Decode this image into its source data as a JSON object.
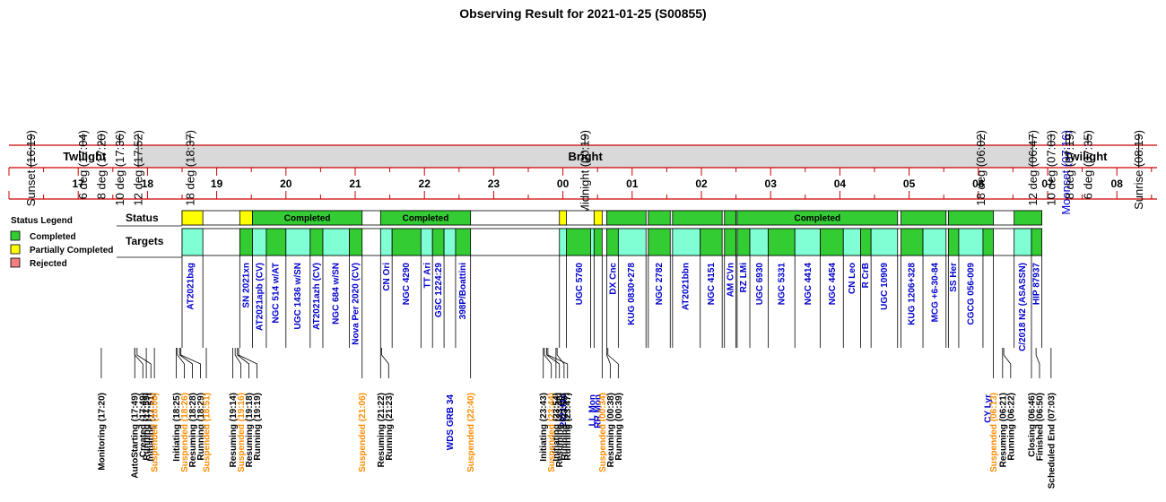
{
  "chart_data": {
    "type": "timeline",
    "title": "Observing Result for 2021-01-25 (S00855)",
    "time_range": [
      "16:00",
      "08:40"
    ],
    "top_markers": [
      {
        "label": "Sunset (16:19)",
        "time": "16:19",
        "color": "#000000"
      },
      {
        "label": "6 deg (17:04)",
        "time": "17:04",
        "color": "#000000"
      },
      {
        "label": "8 deg (17:20)",
        "time": "17:20",
        "color": "#000000"
      },
      {
        "label": "10 deg (17:36)",
        "time": "17:36",
        "color": "#000000"
      },
      {
        "label": "12 deg (17:52)",
        "time": "17:52",
        "color": "#000000"
      },
      {
        "label": "18 deg (18:37)",
        "time": "18:37",
        "color": "#000000"
      },
      {
        "label": "Midnight (00:19)",
        "time": "00:19",
        "color": "#000000"
      },
      {
        "label": "18 deg (06:02)",
        "time": "06:02",
        "color": "#000000"
      },
      {
        "label": "12 deg (06:47)",
        "time": "06:47",
        "color": "#000000"
      },
      {
        "label": "10 deg (07:03)",
        "time": "07:03",
        "color": "#000000"
      },
      {
        "label": "Moonset (07:16)",
        "time": "07:16",
        "color": "#0000cc"
      },
      {
        "label": "8 deg (07:19)",
        "time": "07:19",
        "color": "#000000"
      },
      {
        "label": "6 deg (07:35)",
        "time": "07:35",
        "color": "#000000"
      },
      {
        "label": "Sunrise (08:19)",
        "time": "08:19",
        "color": "#000000"
      }
    ],
    "bands": [
      {
        "label": "Twilight",
        "start": "16:19",
        "end": "17:52",
        "fill": "#ffffff"
      },
      {
        "label": "Bright",
        "start": "17:52",
        "end": "06:47",
        "fill": "#d9d9d9"
      },
      {
        "label": "Twilight",
        "start": "06:47",
        "end": "08:19",
        "fill": "#ffffff"
      }
    ],
    "hour_labels": [
      "17",
      "18",
      "19",
      "20",
      "21",
      "22",
      "23",
      "00",
      "01",
      "02",
      "03",
      "04",
      "05",
      "06",
      "07",
      "08"
    ],
    "legend": {
      "title": "Status Legend",
      "items": [
        {
          "label": "Completed",
          "color": "#33cc33"
        },
        {
          "label": "Partially Completed",
          "color": "#ffff00"
        },
        {
          "label": "Rejected",
          "color": "#f08080"
        }
      ]
    },
    "row_labels": {
      "status": "Status",
      "targets": "Targets"
    },
    "status_blocks": [
      {
        "start": "18:30",
        "end": "18:48",
        "status": "partial",
        "label": ""
      },
      {
        "start": "19:20",
        "end": "19:31",
        "status": "partial",
        "label": ""
      },
      {
        "start": "19:31",
        "end": "21:06",
        "status": "completed",
        "label": "Completed"
      },
      {
        "start": "21:22",
        "end": "22:40",
        "status": "completed",
        "label": "Completed"
      },
      {
        "start": "23:57",
        "end": "00:03",
        "status": "partial",
        "label": ""
      },
      {
        "start": "00:27",
        "end": "00:34",
        "status": "partial",
        "label": ""
      },
      {
        "start": "00:38",
        "end": "01:12",
        "status": "completed",
        "label": ""
      },
      {
        "start": "01:14",
        "end": "01:33",
        "status": "completed",
        "label": ""
      },
      {
        "start": "01:35",
        "end": "02:18",
        "status": "completed",
        "label": ""
      },
      {
        "start": "02:20",
        "end": "02:30",
        "status": "completed",
        "label": ""
      },
      {
        "start": "02:31",
        "end": "04:50",
        "status": "completed",
        "label": "Completed"
      },
      {
        "start": "04:53",
        "end": "05:32",
        "status": "completed",
        "label": ""
      },
      {
        "start": "05:34",
        "end": "06:13",
        "status": "completed",
        "label": ""
      },
      {
        "start": "06:31",
        "end": "06:55",
        "status": "completed",
        "label": ""
      }
    ],
    "target_blocks": [
      {
        "start": "18:30",
        "end": "18:48",
        "color": "#80ffd4",
        "name": "AT2021bag"
      },
      {
        "start": "19:20",
        "end": "19:31",
        "color": "#33cc33",
        "name": "SN 2021xn"
      },
      {
        "start": "19:31",
        "end": "19:43",
        "color": "#80ffd4",
        "name": "AT2021apb (CV)"
      },
      {
        "start": "19:43",
        "end": "20:00",
        "color": "#33cc33",
        "name": "NGC 514 w/AT"
      },
      {
        "start": "20:00",
        "end": "20:21",
        "color": "#80ffd4",
        "name": "UGC 1436 w/SN"
      },
      {
        "start": "20:21",
        "end": "20:32",
        "color": "#33cc33",
        "name": "AT2021azh (CV)"
      },
      {
        "start": "20:32",
        "end": "20:55",
        "color": "#80ffd4",
        "name": "NGC 684 w/SN"
      },
      {
        "start": "20:55",
        "end": "21:06",
        "color": "#33cc33",
        "name": "Nova Per 2020 (CV)"
      },
      {
        "start": "21:22",
        "end": "21:32",
        "color": "#80ffd4",
        "name": "CN Ori"
      },
      {
        "start": "21:32",
        "end": "21:57",
        "color": "#33cc33",
        "name": "NGC 4290"
      },
      {
        "start": "21:57",
        "end": "22:07",
        "color": "#80ffd4",
        "name": "TT Ari"
      },
      {
        "start": "22:07",
        "end": "22:17",
        "color": "#33cc33",
        "name": "GSC 1224:29"
      },
      {
        "start": "22:17",
        "end": "22:27",
        "color": "#80ffd4",
        "name": "WDS GRB 34"
      },
      {
        "start": "22:27",
        "end": "22:40",
        "color": "#33cc33",
        "name": "398P/Boattini"
      },
      {
        "start": "23:57",
        "end": "00:03",
        "color": "#80ffd4",
        "name": "2021Mx"
      },
      {
        "start": "00:03",
        "end": "00:24",
        "color": "#33cc33",
        "name": "UGC 5760"
      },
      {
        "start": "00:24",
        "end": "00:27",
        "color": "#80ffd4",
        "name": "LL Mon"
      },
      {
        "start": "00:27",
        "end": "00:34",
        "color": "#33cc33",
        "name": "RR Mon"
      },
      {
        "start": "00:38",
        "end": "00:48",
        "color": "#33cc33",
        "name": "DX Cnc"
      },
      {
        "start": "00:48",
        "end": "01:12",
        "color": "#80ffd4",
        "name": "KUG 0830+278"
      },
      {
        "start": "01:14",
        "end": "01:33",
        "color": "#33cc33",
        "name": "NGC 2782"
      },
      {
        "start": "01:35",
        "end": "01:59",
        "color": "#80ffd4",
        "name": "AT2021bbn"
      },
      {
        "start": "01:59",
        "end": "02:18",
        "color": "#33cc33",
        "name": "NGC 4151"
      },
      {
        "start": "02:20",
        "end": "02:30",
        "color": "#33cc33",
        "name": "AM CVn"
      },
      {
        "start": "02:31",
        "end": "02:42",
        "color": "#33cc33",
        "name": "RZ LMi"
      },
      {
        "start": "02:42",
        "end": "02:58",
        "color": "#80ffd4",
        "name": "UGC 6930"
      },
      {
        "start": "02:58",
        "end": "03:21",
        "color": "#33cc33",
        "name": "NGC 5331"
      },
      {
        "start": "03:21",
        "end": "03:43",
        "color": "#80ffd4",
        "name": "NGC 4414"
      },
      {
        "start": "03:43",
        "end": "04:03",
        "color": "#33cc33",
        "name": "NGC 4454"
      },
      {
        "start": "04:03",
        "end": "04:18",
        "color": "#80ffd4",
        "name": "CN Leo"
      },
      {
        "start": "04:18",
        "end": "04:27",
        "color": "#33cc33",
        "name": "R CrB"
      },
      {
        "start": "04:27",
        "end": "04:50",
        "color": "#80ffd4",
        "name": "UGC 10909"
      },
      {
        "start": "04:53",
        "end": "05:12",
        "color": "#33cc33",
        "name": "KUG 1206+328"
      },
      {
        "start": "05:12",
        "end": "05:32",
        "color": "#80ffd4",
        "name": "MCG +6-30-84"
      },
      {
        "start": "05:34",
        "end": "05:43",
        "color": "#33cc33",
        "name": "SS Her"
      },
      {
        "start": "05:43",
        "end": "06:04",
        "color": "#80ffd4",
        "name": "CGCG 056-009"
      },
      {
        "start": "06:04",
        "end": "06:13",
        "color": "#33cc33",
        "name": "CY Lyr"
      },
      {
        "start": "06:31",
        "end": "06:46",
        "color": "#80ffd4",
        "name": "C/2018 N2 (ASASSN)"
      },
      {
        "start": "06:46",
        "end": "06:55",
        "color": "#33cc33",
        "name": "HIP 87937"
      }
    ],
    "target_labels": [
      {
        "name": "AT2021bag",
        "time": "18:37",
        "color": "#0000cc",
        "drop": 0
      },
      {
        "name": "SN 2021xn",
        "time": "19:25",
        "color": "#0000cc",
        "drop": 0
      },
      {
        "name": "AT2021apb (CV)",
        "time": "19:37",
        "color": "#0000cc",
        "drop": 0
      },
      {
        "name": "NGC 514 w/AT",
        "time": "19:51",
        "color": "#0000cc",
        "drop": 0
      },
      {
        "name": "UGC 1436 w/SN",
        "time": "20:10",
        "color": "#0000cc",
        "drop": 0
      },
      {
        "name": "AT2021azh (CV)",
        "time": "20:26",
        "color": "#0000cc",
        "drop": 0
      },
      {
        "name": "NGC 684 w/SN",
        "time": "20:43",
        "color": "#0000cc",
        "drop": 0
      },
      {
        "name": "Nova Per 2020 (CV)",
        "time": "21:00",
        "color": "#0000cc",
        "drop": 0
      },
      {
        "name": "CN Ori",
        "time": "21:27",
        "color": "#0000cc",
        "drop": 0
      },
      {
        "name": "NGC 4290",
        "time": "21:44",
        "color": "#0000cc",
        "drop": 0
      },
      {
        "name": "TT Ari",
        "time": "22:02",
        "color": "#0000cc",
        "drop": 0
      },
      {
        "name": "GSC 1224:29",
        "time": "22:12",
        "color": "#0000cc",
        "drop": 0
      },
      {
        "name": "WDS GRB 34",
        "time": "22:22",
        "color": "#0000cc",
        "drop": 1
      },
      {
        "name": "398P/Boattini",
        "time": "22:33",
        "color": "#0000cc",
        "drop": 0
      },
      {
        "name": "2021Mx",
        "time": "00:00",
        "color": "#0000cc",
        "drop": 1
      },
      {
        "name": "UGC 5760",
        "time": "00:14",
        "color": "#0000cc",
        "drop": 0
      },
      {
        "name": "LL Mon",
        "time": "00:25",
        "color": "#0000cc",
        "drop": 1
      },
      {
        "name": "RR Mon",
        "time": "00:30",
        "color": "#0000cc",
        "drop": 1
      },
      {
        "name": "DX Cnc",
        "time": "00:43",
        "color": "#0000cc",
        "drop": 0
      },
      {
        "name": "KUG 0830+278",
        "time": "00:59",
        "color": "#0000cc",
        "drop": 0
      },
      {
        "name": "NGC 2782",
        "time": "01:23",
        "color": "#0000cc",
        "drop": 0
      },
      {
        "name": "AT2021bbn",
        "time": "01:46",
        "color": "#0000cc",
        "drop": 0
      },
      {
        "name": "NGC 4151",
        "time": "02:08",
        "color": "#0000cc",
        "drop": 0
      },
      {
        "name": "AM CVn",
        "time": "02:25",
        "color": "#0000cc",
        "drop": 0
      },
      {
        "name": "RZ LMi",
        "time": "02:36",
        "color": "#0000cc",
        "drop": 0
      },
      {
        "name": "UGC 6930",
        "time": "02:50",
        "color": "#0000cc",
        "drop": 0
      },
      {
        "name": "NGC 5331",
        "time": "03:09",
        "color": "#0000cc",
        "drop": 0
      },
      {
        "name": "NGC 4414",
        "time": "03:32",
        "color": "#0000cc",
        "drop": 0
      },
      {
        "name": "NGC 4454",
        "time": "03:53",
        "color": "#0000cc",
        "drop": 0
      },
      {
        "name": "CN Leo",
        "time": "04:10",
        "color": "#0000cc",
        "drop": 0
      },
      {
        "name": "R CrB",
        "time": "04:22",
        "color": "#0000cc",
        "drop": 0
      },
      {
        "name": "UGC 10909",
        "time": "04:38",
        "color": "#0000cc",
        "drop": 0
      },
      {
        "name": "KUG 1206+328",
        "time": "05:02",
        "color": "#0000cc",
        "drop": 0
      },
      {
        "name": "MCG +6-30-84",
        "time": "05:22",
        "color": "#0000cc",
        "drop": 0
      },
      {
        "name": "SS Her",
        "time": "05:38",
        "color": "#0000cc",
        "drop": 0
      },
      {
        "name": "CGCG 056-009",
        "time": "05:53",
        "color": "#0000cc",
        "drop": 0
      },
      {
        "name": "CY Lyr",
        "time": "06:08",
        "color": "#0000cc",
        "drop": 1
      },
      {
        "name": "C/2018 N2 (ASASSN)",
        "time": "06:38",
        "color": "#0000cc",
        "drop": 0
      },
      {
        "name": "HIP 87937",
        "time": "06:50",
        "color": "#0000cc",
        "drop": 0
      }
    ],
    "events": [
      {
        "label": "Monitoring (17:20)",
        "time": "17:20",
        "color": "#000000"
      },
      {
        "label": "AutoStarting (17:49)",
        "time": "17:49",
        "color": "#000000"
      },
      {
        "label": "Created (17:49)",
        "time": "17:49",
        "color": "#000000"
      },
      {
        "label": "Initiating (17:51)",
        "time": "17:51",
        "color": "#000000"
      },
      {
        "label": "Running (17:59)",
        "time": "17:59",
        "color": "#000000"
      },
      {
        "label": "Suspended (18:06)",
        "time": "18:06",
        "color": "#ff8c00"
      },
      {
        "label": "Initiating (18:25)",
        "time": "18:25",
        "color": "#000000"
      },
      {
        "label": "Suspended (18:26)",
        "time": "18:26",
        "color": "#ff8c00"
      },
      {
        "label": "Resuming (18:28)",
        "time": "18:28",
        "color": "#000000"
      },
      {
        "label": "Running (18:29)",
        "time": "18:29",
        "color": "#000000"
      },
      {
        "label": "Suspended (18:51)",
        "time": "18:51",
        "color": "#ff8c00"
      },
      {
        "label": "Resuming (19:14)",
        "time": "19:14",
        "color": "#000000"
      },
      {
        "label": "Suspended (19:16)",
        "time": "19:16",
        "color": "#ff8c00"
      },
      {
        "label": "Resuming (19:18)",
        "time": "19:18",
        "color": "#000000"
      },
      {
        "label": "Running (19:19)",
        "time": "19:19",
        "color": "#000000"
      },
      {
        "label": "Suspended (21:06)",
        "time": "21:06",
        "color": "#ff8c00"
      },
      {
        "label": "Resuming (21:22)",
        "time": "21:22",
        "color": "#000000"
      },
      {
        "label": "Running (21:23)",
        "time": "21:23",
        "color": "#000000"
      },
      {
        "label": "Suspended (22:40)",
        "time": "22:40",
        "color": "#ff8c00"
      },
      {
        "label": "Initiating (23:43)",
        "time": "23:43",
        "color": "#000000"
      },
      {
        "label": "Suspended (23:44)",
        "time": "23:44",
        "color": "#ff8c00"
      },
      {
        "label": "Resuming (23:46)",
        "time": "23:46",
        "color": "#000000"
      },
      {
        "label": "Running (23:47)",
        "time": "23:47",
        "color": "#000000"
      },
      {
        "label": "Initiating (23:54)",
        "time": "23:54",
        "color": "#000000"
      },
      {
        "label": "Running (23:55)",
        "time": "23:55",
        "color": "#000000"
      },
      {
        "label": "Suspended (00:34)",
        "time": "00:34",
        "color": "#ff8c00"
      },
      {
        "label": "Resuming (00:38)",
        "time": "00:38",
        "color": "#000000"
      },
      {
        "label": "Running (00:39)",
        "time": "00:39",
        "color": "#000000"
      },
      {
        "label": "Suspended (06:13)",
        "time": "06:13",
        "color": "#ff8c00"
      },
      {
        "label": "Resuming (06:21)",
        "time": "06:21",
        "color": "#000000"
      },
      {
        "label": "Running (06:22)",
        "time": "06:22",
        "color": "#000000"
      },
      {
        "label": "Closing (06:46)",
        "time": "06:46",
        "color": "#000000"
      },
      {
        "label": "Finished (06:50)",
        "time": "06:50",
        "color": "#000000"
      },
      {
        "label": "Scheduled End (07:03)",
        "time": "07:03",
        "color": "#000000"
      }
    ],
    "colors": {
      "completed": "#33cc33",
      "partial": "#ffff00",
      "rejected": "#f08080",
      "target_alt": "#80ffd4",
      "timeline_red": "#cc0000",
      "label_blue": "#0000cc",
      "suspended_orange": "#ff8c00",
      "bright_fill": "#d9d9d9"
    }
  }
}
